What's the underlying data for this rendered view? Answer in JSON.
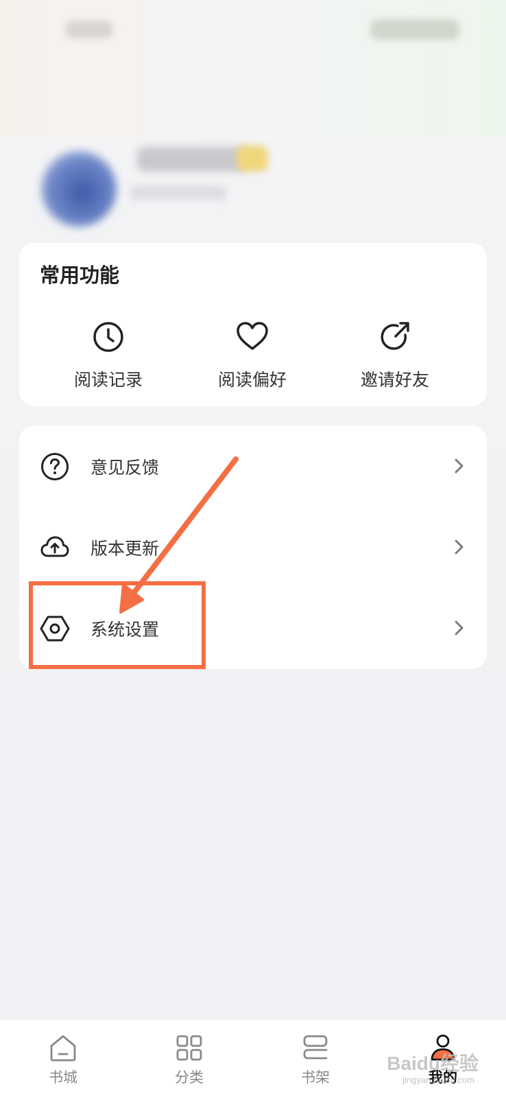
{
  "common": {
    "title": "常用功能",
    "items": [
      {
        "label": "阅读记录",
        "icon": "clock-icon"
      },
      {
        "label": "阅读偏好",
        "icon": "heart-icon"
      },
      {
        "label": "邀请好友",
        "icon": "share-icon"
      }
    ]
  },
  "menu": {
    "items": [
      {
        "label": "意见反馈",
        "icon": "question-icon"
      },
      {
        "label": "版本更新",
        "icon": "cloud-upload-icon"
      },
      {
        "label": "系统设置",
        "icon": "settings-hex-icon"
      }
    ]
  },
  "tabbar": {
    "items": [
      {
        "label": "书城",
        "icon": "home-icon"
      },
      {
        "label": "分类",
        "icon": "grid-icon"
      },
      {
        "label": "书架",
        "icon": "shelf-icon"
      },
      {
        "label": "我的",
        "icon": "user-icon",
        "active": true
      }
    ]
  },
  "watermark": {
    "text": "Baidu经验",
    "sub": "jingyan.baidu.com"
  },
  "colors": {
    "annotation": "#f46e44",
    "card": "#ffffff",
    "background": "#f1f2f5"
  }
}
